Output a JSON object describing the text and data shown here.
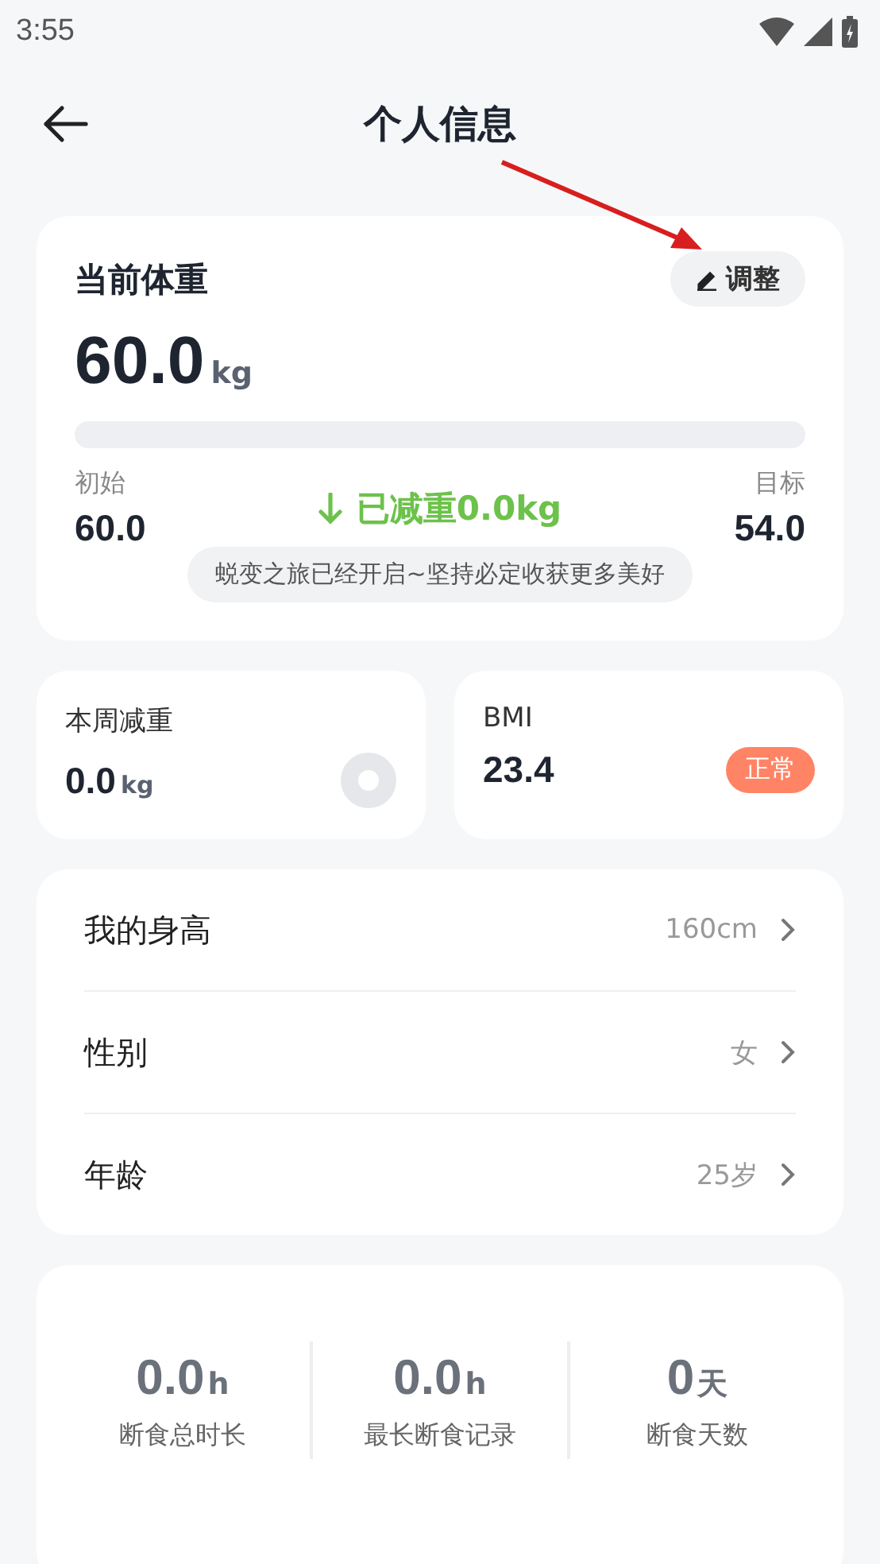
{
  "status_bar": {
    "time": "3:55"
  },
  "header": {
    "title": "个人信息"
  },
  "weight_card": {
    "title": "当前体重",
    "adjust_button": "调整",
    "value": "60.0",
    "unit": "kg",
    "progress": {
      "level": 0
    },
    "start_label": "初始",
    "start_value": "60.0",
    "lost_text": "已减重0.0kg",
    "target_label": "目标",
    "target_value": "54.0",
    "motto": "蜕变之旅已经开启~坚持必定收获更多美好"
  },
  "week_card": {
    "title": "本周减重",
    "value": "0.0",
    "unit": "kg"
  },
  "bmi_card": {
    "title": "BMI",
    "value": "23.4",
    "badge": "正常"
  },
  "profile_rows": [
    {
      "label": "我的身高",
      "value": "160cm"
    },
    {
      "label": "性别",
      "value": "女"
    },
    {
      "label": "年龄",
      "value": "25岁"
    }
  ],
  "fasting_stats": [
    {
      "value": "0.0",
      "unit": "h",
      "label": "断食总时长"
    },
    {
      "value": "0.0",
      "unit": "h",
      "label": "最长断食记录"
    },
    {
      "value": "0",
      "unit": "天",
      "label": "断食天数"
    }
  ]
}
